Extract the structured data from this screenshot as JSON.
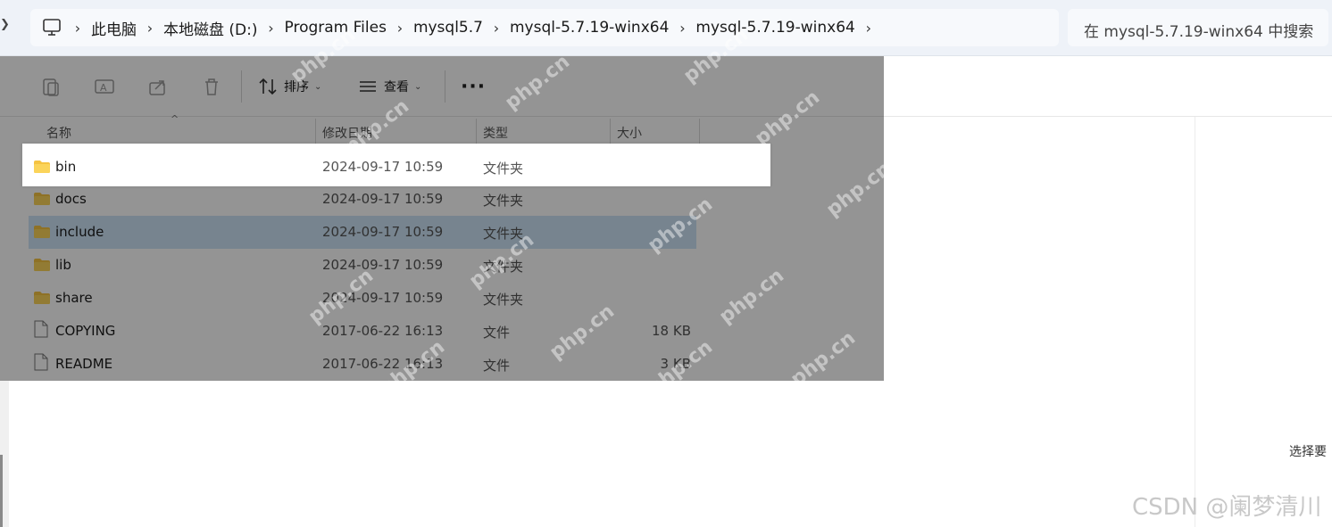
{
  "address_bar": {
    "breadcrumbs": [
      "此电脑",
      "本地磁盘 (D:)",
      "Program Files",
      "mysql5.7",
      "mysql-5.7.19-winx64",
      "mysql-5.7.19-winx64"
    ],
    "search_placeholder": "在 mysql-5.7.19-winx64 中搜索"
  },
  "toolbar": {
    "sort_label": "排序",
    "view_label": "查看",
    "more_label": "···"
  },
  "columns": {
    "name": "名称",
    "date": "修改日期",
    "type": "类型",
    "size": "大小"
  },
  "files": [
    {
      "name": "bin",
      "date": "2024-09-17 10:59",
      "type": "文件夹",
      "size": "",
      "kind": "folder"
    },
    {
      "name": "docs",
      "date": "2024-09-17 10:59",
      "type": "文件夹",
      "size": "",
      "kind": "folder"
    },
    {
      "name": "include",
      "date": "2024-09-17 10:59",
      "type": "文件夹",
      "size": "",
      "kind": "folder"
    },
    {
      "name": "lib",
      "date": "2024-09-17 10:59",
      "type": "文件夹",
      "size": "",
      "kind": "folder"
    },
    {
      "name": "share",
      "date": "2024-09-17 10:59",
      "type": "文件夹",
      "size": "",
      "kind": "folder"
    },
    {
      "name": "COPYING",
      "date": "2017-06-22 16:13",
      "type": "文件",
      "size": "18 KB",
      "kind": "file"
    },
    {
      "name": "README",
      "date": "2017-06-22 16:13",
      "type": "文件",
      "size": "3 KB",
      "kind": "file"
    }
  ],
  "details_pane_hint": "选择要",
  "watermark": "php.cn",
  "csdn_watermark": "CSDN @阑梦清川",
  "colors": {
    "folder": "#f5c342",
    "selection": "#cde4f7",
    "address_bg": "#eef2f8"
  }
}
